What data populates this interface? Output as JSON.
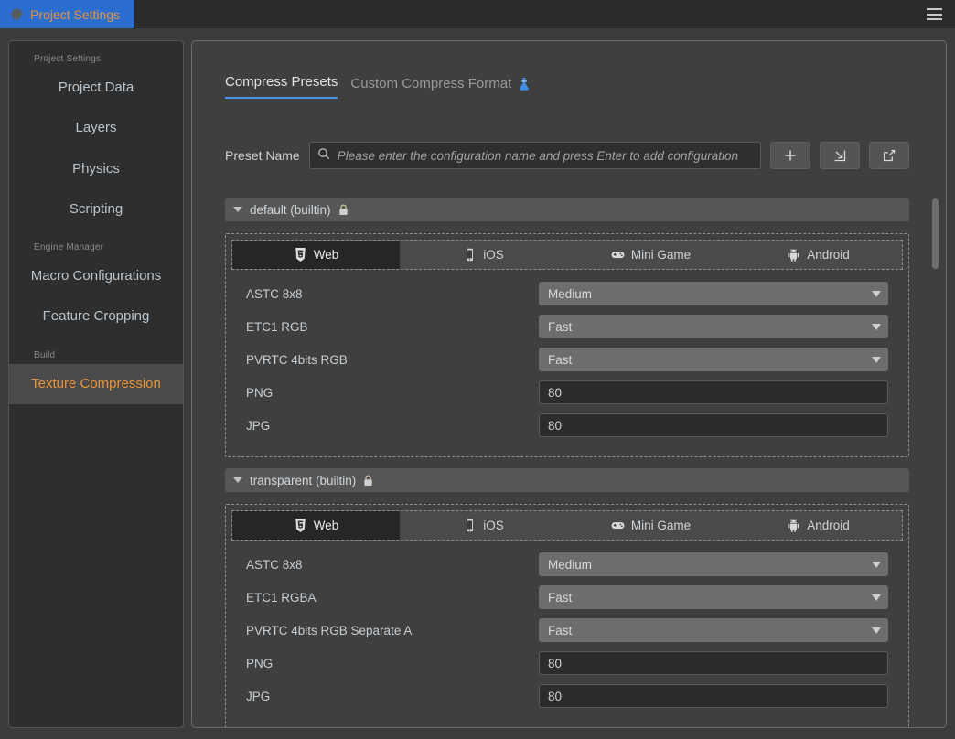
{
  "window": {
    "tab_title": "Project Settings",
    "gear_icon": "gear-icon",
    "menu_icon": "hamburger-menu-icon"
  },
  "sidebar": {
    "groups": [
      {
        "section": "Project Settings",
        "items": [
          {
            "label": "Project Data",
            "selected": false
          },
          {
            "label": "Layers",
            "selected": false
          },
          {
            "label": "Physics",
            "selected": false
          },
          {
            "label": "Scripting",
            "selected": false
          }
        ]
      },
      {
        "section": "Engine Manager",
        "items": [
          {
            "label": "Macro Configurations",
            "selected": false
          },
          {
            "label": "Feature Cropping",
            "selected": false
          }
        ]
      },
      {
        "section": "Build",
        "items": [
          {
            "label": "Texture Compression",
            "selected": true
          }
        ]
      }
    ],
    "selected_color": "#e8943a"
  },
  "main": {
    "tabs": [
      {
        "label": "Compress Presets",
        "active": true,
        "icon": null
      },
      {
        "label": "Custom Compress Format",
        "active": false,
        "icon": "flask-icon"
      }
    ],
    "preset": {
      "label": "Preset Name",
      "search_icon": "search-icon",
      "input_value": "",
      "placeholder": "Please enter the configuration name and press Enter to add configuration",
      "buttons": [
        {
          "name": "add-preset-button",
          "icon": "plus-icon",
          "label": "+"
        },
        {
          "name": "import-preset-button",
          "icon": "import-arrow-icon",
          "label": ""
        },
        {
          "name": "export-preset-button",
          "icon": "export-arrow-icon",
          "label": ""
        }
      ]
    },
    "platform_tabs": [
      {
        "label": "Web",
        "icon": "html5-icon",
        "active": true
      },
      {
        "label": "iOS",
        "icon": "phone-icon",
        "active": false
      },
      {
        "label": "Mini Game",
        "icon": "gamepad-icon",
        "active": false
      },
      {
        "label": "Android",
        "icon": "android-icon",
        "active": false
      }
    ],
    "groups": [
      {
        "title": "default (builtin)",
        "locked": true,
        "lock_icon": "lock-icon",
        "expanded": true,
        "rows": [
          {
            "label": "ASTC 8x8",
            "type": "select",
            "value": "Medium"
          },
          {
            "label": "ETC1 RGB",
            "type": "select",
            "value": "Fast"
          },
          {
            "label": "PVRTC 4bits RGB",
            "type": "select",
            "value": "Fast"
          },
          {
            "label": "PNG",
            "type": "text",
            "value": "80"
          },
          {
            "label": "JPG",
            "type": "text",
            "value": "80"
          }
        ]
      },
      {
        "title": "transparent (builtin)",
        "locked": true,
        "lock_icon": "lock-icon",
        "expanded": true,
        "rows": [
          {
            "label": "ASTC 8x8",
            "type": "select",
            "value": "Medium"
          },
          {
            "label": "ETC1 RGBA",
            "type": "select",
            "value": "Fast"
          },
          {
            "label": "PVRTC 4bits RGB Separate A",
            "type": "select",
            "value": "Fast"
          },
          {
            "label": "PNG",
            "type": "text",
            "value": "80"
          },
          {
            "label": "JPG",
            "type": "text",
            "value": "80"
          }
        ]
      }
    ]
  },
  "colors": {
    "accent_blue": "#2b6ed0",
    "accent_orange": "#e8943a",
    "tab_underline": "#4a8fe0",
    "panel_bg": "#3f3f3f",
    "sidebar_bg": "#2e2e2e"
  }
}
